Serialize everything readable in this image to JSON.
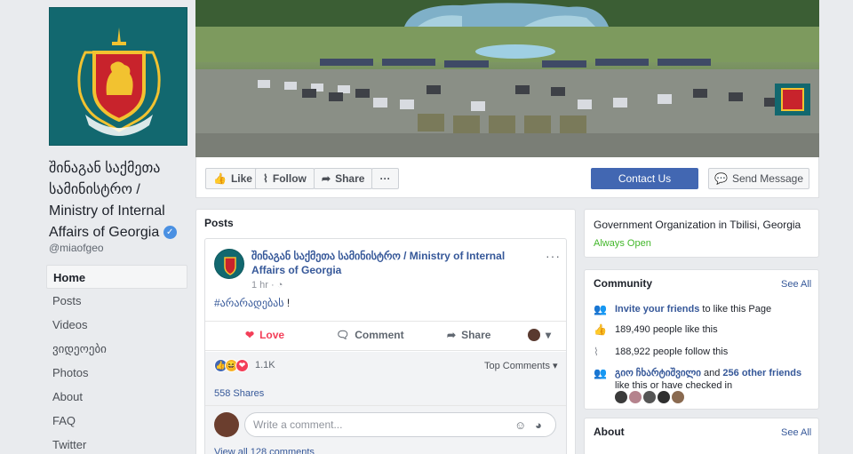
{
  "page": {
    "name": "შინაგან საქმეთა სამინისტრო / Ministry of Internal Affairs of Georgia",
    "verified_mark": "✓",
    "handle": "@miaofgeo"
  },
  "nav": [
    {
      "label": "Home",
      "active": true
    },
    {
      "label": "Posts"
    },
    {
      "label": "Videos"
    },
    {
      "label": "ვიდეოები"
    },
    {
      "label": "Photos"
    },
    {
      "label": "About"
    },
    {
      "label": "FAQ"
    },
    {
      "label": "Twitter"
    }
  ],
  "actions": {
    "like": "Like",
    "follow": "Follow",
    "share": "Share",
    "more": "···",
    "contact": "Contact Us",
    "message": "Send Message"
  },
  "posts": {
    "title": "Posts",
    "author": "შინაგან საქმეთა სამინისტრო / Ministry of Internal Affairs of Georgia",
    "time": "1 hr",
    "more": "···",
    "hashtag": "#არარადებას",
    "text_suffix": " !",
    "love": "Love",
    "comment": "Comment",
    "share": "Share",
    "reactions_count": "1.1K",
    "top_comments": "Top Comments",
    "shares": "558 Shares",
    "comment_placeholder": "Write a comment...",
    "view_all": "View all 128 comments"
  },
  "info": {
    "org_type": "Government Organization in Tbilisi, Georgia",
    "hours": "Always Open"
  },
  "community": {
    "title": "Community",
    "see_all": "See All",
    "invite_link": "Invite your friends",
    "invite_rest": " to like this Page",
    "likes": "189,490 people like this",
    "follows": "188,922 people follow this",
    "friend_name": "გიო ჩხარტიშვილი",
    "friend_mid": " and ",
    "friend_others": "256 other friends",
    "friend_rest": " like this or have checked in"
  },
  "about": {
    "title": "About",
    "see_all": "See All"
  },
  "colors": {
    "brand": "#4267b2",
    "link": "#365899",
    "love": "#f33e58",
    "open": "#42b72a",
    "profile_bg": "#12686f"
  }
}
